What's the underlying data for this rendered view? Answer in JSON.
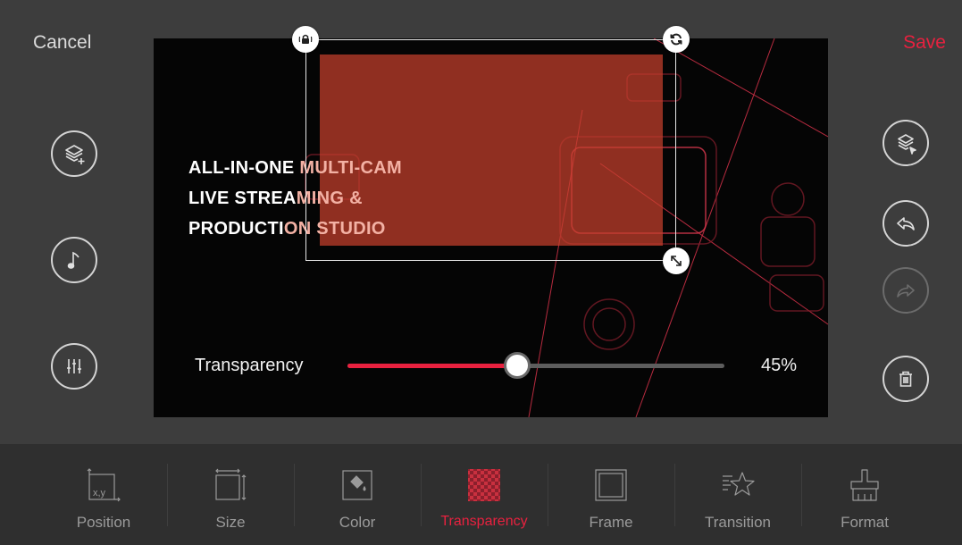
{
  "header": {
    "cancel_label": "Cancel",
    "save_label": "Save"
  },
  "canvas": {
    "headline_white_1": "ALL-IN-ONE ",
    "headline_accent_1": "MULTI-CAM",
    "headline_white_2": "LIVE STREA",
    "headline_accent_2": "MING &",
    "headline_white_3": "PRODUCTI",
    "headline_accent_3": "ON STUDIO"
  },
  "left_tools": [
    {
      "icon": "add-layer-icon"
    },
    {
      "icon": "music-note-icon"
    },
    {
      "icon": "equalizer-icon"
    }
  ],
  "right_tools": [
    {
      "icon": "select-layer-icon"
    },
    {
      "icon": "undo-icon"
    },
    {
      "icon": "redo-icon",
      "disabled": true
    },
    {
      "icon": "trash-icon"
    }
  ],
  "slider": {
    "label": "Transparency",
    "value": 45,
    "value_text": "45%"
  },
  "toolbar": {
    "active": "Transparency",
    "items": [
      {
        "label": "Position",
        "icon": "position-icon"
      },
      {
        "label": "Size",
        "icon": "size-icon"
      },
      {
        "label": "Color",
        "icon": "color-fill-icon"
      },
      {
        "label": "Transparency",
        "icon": "transparency-icon"
      },
      {
        "label": "Frame",
        "icon": "frame-icon"
      },
      {
        "label": "Transition",
        "icon": "transition-star-icon"
      },
      {
        "label": "Format",
        "icon": "format-brush-icon"
      }
    ]
  },
  "colors": {
    "accent": "#e8213f",
    "overlay": "#c6402d",
    "toolbar_bg": "#2f2f2f",
    "panel_bg": "#3d3d3d"
  }
}
